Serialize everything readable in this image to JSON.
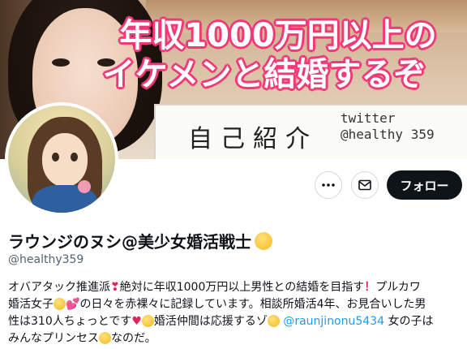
{
  "banner": {
    "headline_line1": "年収1000万円以上の",
    "headline_line2": "イケメンと結婚するぞ",
    "board_label": "自己紹介",
    "board_twitter": "twitter",
    "board_handle": "@healthy 359"
  },
  "actions": {
    "more_icon": "more-horizontal-icon",
    "message_icon": "mail-icon",
    "follow_label": "フォロー"
  },
  "profile": {
    "display_name": "ラウンジのヌシ@美少女婚活戦士",
    "handle": "@healthy359",
    "bio": {
      "l1a": "オバアタック推進派",
      "l1b": "絶対に年収1000万円以上男性との結婚を目指す",
      "l1c": "プルカワ",
      "l2a": "婚活女子",
      "l2b": "の日々を赤裸々に記録しています。相談所婚活4年、お見合いした男",
      "l3a": "性は310人ちょっとです",
      "l3b": "婚活仲間は応援するゾ",
      "mention": "@raunjinonu5434",
      "l3c": "女の子は",
      "l4a": "みんなプリンセス",
      "l4b": "なのだ。"
    }
  },
  "colors": {
    "follow_bg": "#0f1419",
    "headline_outline": "#f03a78",
    "mention": "#1d9bf0",
    "handle": "#536471"
  }
}
